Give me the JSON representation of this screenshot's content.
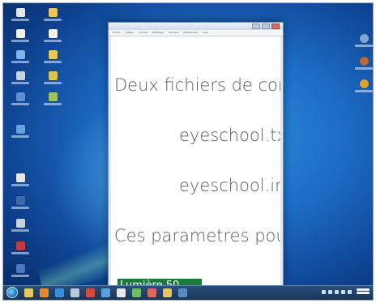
{
  "desktop": {
    "icons_left": [
      {
        "name": "computer-icon",
        "color": "#dfe6ee"
      },
      {
        "name": "folder-icon",
        "color": "#e9c65a"
      },
      {
        "name": "document-icon",
        "color": "#f2f2f2"
      },
      {
        "name": "document-icon",
        "color": "#f2f2f2"
      },
      {
        "name": "network-icon",
        "color": "#7bb5ea"
      },
      {
        "name": "folder-icon",
        "color": "#e9c65a"
      },
      {
        "name": "recycle-bin-icon",
        "color": "#c8d3e0"
      },
      {
        "name": "folder-icon",
        "color": "#d9c45a"
      },
      {
        "name": "program-icon",
        "color": "#5c8fd6"
      },
      {
        "name": "folder-icon",
        "color": "#9ec45a"
      },
      {
        "name": "program-icon",
        "color": "#6aa0e0"
      },
      {
        "name": "program-icon",
        "color": "#e8e8e8"
      },
      {
        "name": "program-icon",
        "color": "#3a6bb0"
      },
      {
        "name": "program-icon",
        "color": "#c8d3e0"
      },
      {
        "name": "program-icon",
        "color": "#c23a3a"
      },
      {
        "name": "program-icon",
        "color": "#4a7bc0"
      }
    ],
    "icons_right": [
      {
        "name": "program-icon",
        "color": "#7fa6d8"
      },
      {
        "name": "program-icon",
        "color": "#b86a3a"
      },
      {
        "name": "program-icon",
        "color": "#d8a43a"
      }
    ]
  },
  "window": {
    "title": "",
    "menu_items": [
      "Fichier",
      "Edition",
      "Format",
      "Affichage",
      "Musique",
      "Préférences",
      "Aide"
    ],
    "lines": [
      "Deux fichiers de con",
      "eyeschool.tx",
      "eyeschool.in",
      "Ces parametres pou"
    ],
    "status": "Lumière  50"
  },
  "taskbar": {
    "pinned": [
      {
        "name": "folder-icon",
        "color": "#e9c65a"
      },
      {
        "name": "media-player-icon",
        "color": "#e88a2a"
      },
      {
        "name": "browser-icon",
        "color": "#3a8ee0"
      },
      {
        "name": "program-icon",
        "color": "#b8c8dc"
      },
      {
        "name": "program-icon",
        "color": "#d84a3a"
      },
      {
        "name": "program-icon",
        "color": "#5aa0e0"
      },
      {
        "name": "program-icon",
        "color": "#e8e8e8"
      },
      {
        "name": "program-icon",
        "color": "#6ac05a"
      },
      {
        "name": "program-icon",
        "color": "#d86a5a"
      },
      {
        "name": "program-icon",
        "color": "#e8c45a"
      },
      {
        "name": "program-icon",
        "color": "#5a8ac0"
      }
    ]
  }
}
